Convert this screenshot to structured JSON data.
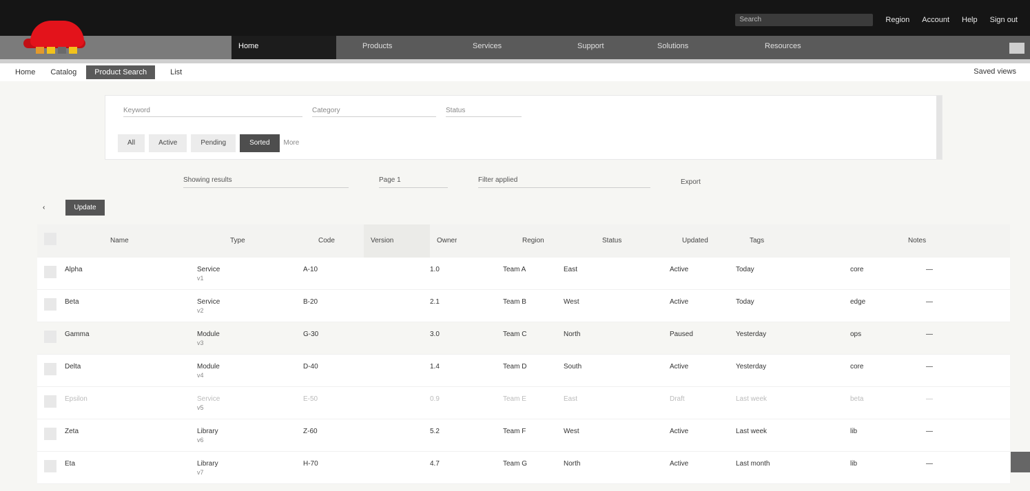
{
  "top": {
    "search_placeholder": "Search",
    "links": [
      "Region",
      "Account",
      "Help",
      "Sign out"
    ]
  },
  "nav": {
    "tabs": [
      "Home",
      "Products",
      "Services",
      "Support",
      "Solutions",
      "Resources"
    ]
  },
  "breadcrumbs": {
    "items": [
      "Home",
      "Catalog",
      "Product Search",
      "List"
    ],
    "right": "Saved views"
  },
  "filters": {
    "fields": [
      "Keyword",
      "Category",
      "Status"
    ],
    "chips": [
      "All",
      "Active",
      "Pending",
      "Sorted",
      "More"
    ]
  },
  "summary": [
    "Showing results",
    "Page 1",
    "Filter applied",
    "Export"
  ],
  "pager": {
    "prev": "‹",
    "button": "Update"
  },
  "table": {
    "headers": [
      "Name",
      "Type",
      "Code",
      "Version",
      "Owner",
      "Region",
      "Status",
      "Updated",
      "Tags",
      "Notes"
    ],
    "rows": [
      {
        "name": "Alpha",
        "type": "Service",
        "code": "A-10",
        "version": "1.0",
        "owner": "Team A",
        "region": "East",
        "status": "Active",
        "updated": "Today",
        "tags": "core",
        "notes": "—",
        "sub": "v1"
      },
      {
        "name": "Beta",
        "type": "Service",
        "code": "B-20",
        "version": "2.1",
        "owner": "Team B",
        "region": "West",
        "status": "Active",
        "updated": "Today",
        "tags": "edge",
        "notes": "—",
        "sub": "v2"
      },
      {
        "name": "Gamma",
        "type": "Module",
        "code": "G-30",
        "version": "3.0",
        "owner": "Team C",
        "region": "North",
        "status": "Paused",
        "updated": "Yesterday",
        "tags": "ops",
        "notes": "—",
        "sub": "v3"
      },
      {
        "name": "Delta",
        "type": "Module",
        "code": "D-40",
        "version": "1.4",
        "owner": "Team D",
        "region": "South",
        "status": "Active",
        "updated": "Yesterday",
        "tags": "core",
        "notes": "—",
        "sub": "v4"
      },
      {
        "name": "Epsilon",
        "type": "Service",
        "code": "E-50",
        "version": "0.9",
        "owner": "Team E",
        "region": "East",
        "status": "Draft",
        "updated": "Last week",
        "tags": "beta",
        "notes": "—",
        "sub": "v5"
      },
      {
        "name": "Zeta",
        "type": "Library",
        "code": "Z-60",
        "version": "5.2",
        "owner": "Team F",
        "region": "West",
        "status": "Active",
        "updated": "Last week",
        "tags": "lib",
        "notes": "—",
        "sub": "v6"
      },
      {
        "name": "Eta",
        "type": "Library",
        "code": "H-70",
        "version": "4.7",
        "owner": "Team G",
        "region": "North",
        "status": "Active",
        "updated": "Last month",
        "tags": "lib",
        "notes": "—",
        "sub": "v7"
      }
    ]
  }
}
